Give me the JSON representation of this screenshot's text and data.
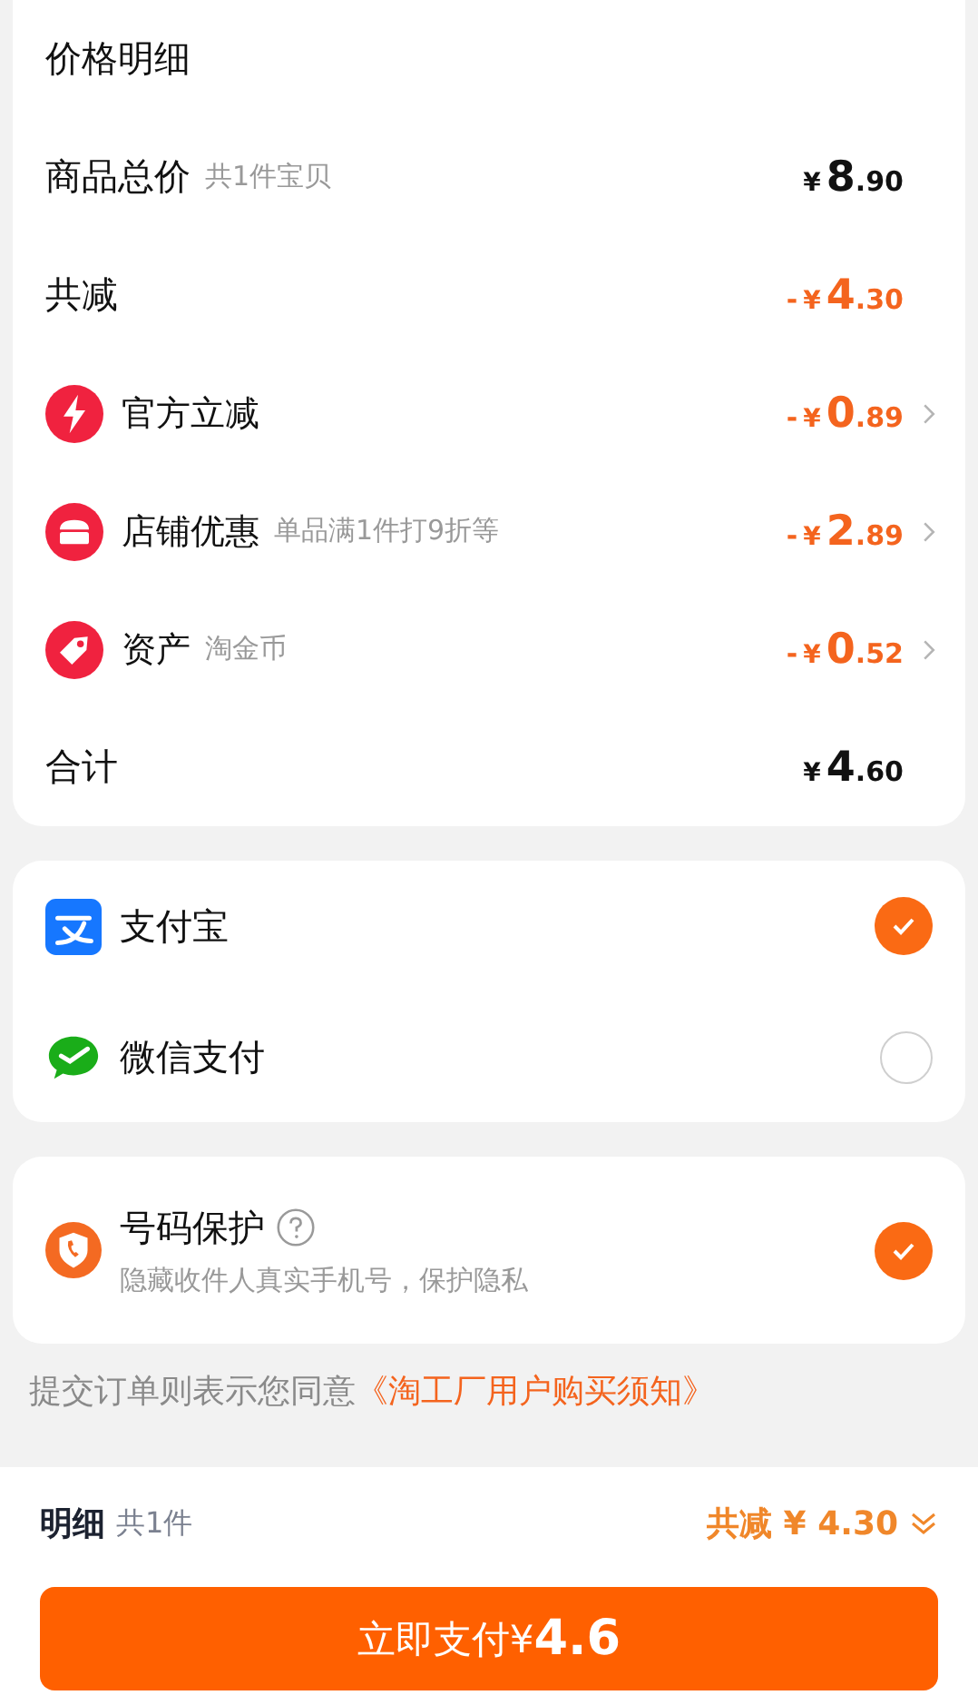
{
  "price_detail": {
    "title": "价格明细",
    "rows": [
      {
        "kind": "plain",
        "label": "商品总价",
        "note": "共1件宝贝",
        "price": {
          "currency": "¥",
          "integer": "8",
          "decimal": ".90"
        },
        "expandable": false
      },
      {
        "kind": "discount",
        "label": "共减",
        "price": {
          "sign": "-",
          "currency": "¥",
          "integer": "4",
          "decimal": ".30"
        },
        "expandable": false
      },
      {
        "kind": "official",
        "label": "官方立减",
        "price": {
          "sign": "-",
          "currency": "¥",
          "integer": "0",
          "decimal": ".89"
        },
        "expandable": true
      },
      {
        "kind": "shop",
        "label": "店铺优惠",
        "note": "单品满1件打9折等",
        "price": {
          "sign": "-",
          "currency": "¥",
          "integer": "2",
          "decimal": ".89"
        },
        "expandable": true
      },
      {
        "kind": "asset",
        "label": "资产",
        "note": "淘金币",
        "price": {
          "sign": "-",
          "currency": "¥",
          "integer": "0",
          "decimal": ".52"
        },
        "expandable": true
      },
      {
        "kind": "plain",
        "label": "合计",
        "price": {
          "currency": "¥",
          "integer": "4",
          "decimal": ".60"
        },
        "expandable": false
      }
    ]
  },
  "payment_methods": [
    {
      "name": "支付宝",
      "selected": true
    },
    {
      "name": "微信支付",
      "selected": false
    }
  ],
  "number_protection": {
    "title": "号码保护",
    "description": "隐藏收件人真实手机号，保护隐私",
    "checked": true
  },
  "agreement": {
    "text": "提交订单则表示您同意",
    "link": "《淘工厂用户购买须知》"
  },
  "footer": {
    "label": "明细",
    "count": "共1件",
    "savings_label": "共减",
    "savings": "¥ 4.30",
    "button": {
      "label": "立即支付",
      "currency": "¥",
      "amount": "4.6"
    }
  }
}
